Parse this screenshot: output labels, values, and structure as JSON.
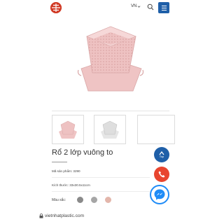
{
  "header": {
    "language": "VN",
    "colors": {
      "brand_blue": "#1f5fa8",
      "logo_red": "#d13a25"
    }
  },
  "product": {
    "title": "Rổ 2 lớp vuông to",
    "sku_label": "Mã sản phẩm:",
    "sku_value": "3290",
    "size_label": "Kích thước:",
    "size_value": "33x30.5x11cm",
    "colors_label": "Màu sắc:",
    "color_options": [
      "#8a8a8a",
      "#a6a6a6",
      "#e3b6ab"
    ],
    "image_color": "#efc4c4"
  },
  "thumbnails": [
    {
      "name": "thumb-1",
      "active": true
    },
    {
      "name": "thumb-2",
      "active": false
    },
    {
      "name": "thumb-3",
      "active": false
    }
  ],
  "floating": {
    "top_label": "Top"
  },
  "browser": {
    "url": "vietnhatplastic.com"
  },
  "icons": [
    "logo-icon",
    "chevron-down-icon",
    "search-icon",
    "menu-icon",
    "arrow-up-icon",
    "phone-icon",
    "messenger-icon",
    "lock-icon"
  ]
}
